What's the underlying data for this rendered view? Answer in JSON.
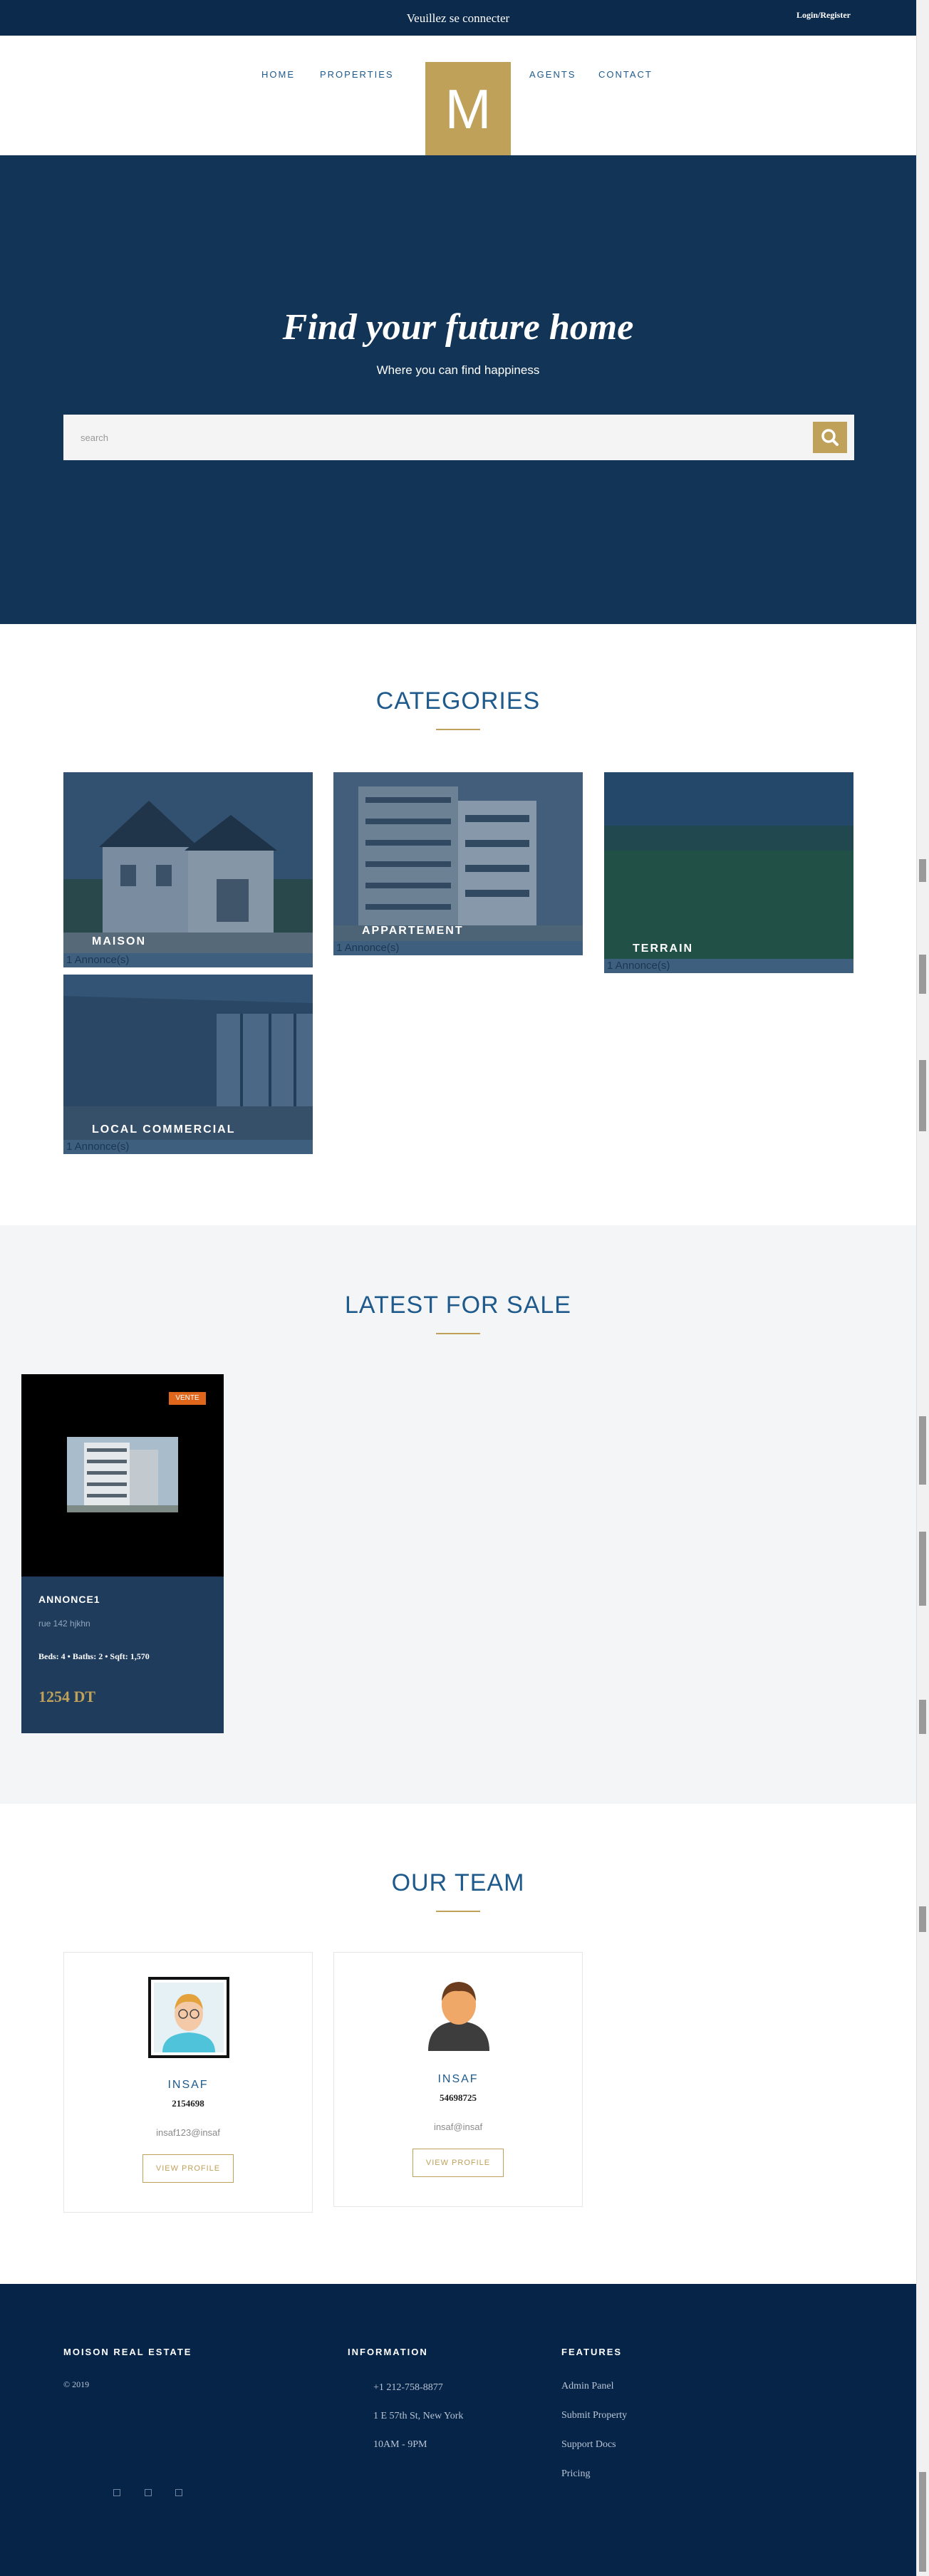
{
  "topbar": {
    "notice": "Veuillez se connecter",
    "login": "Login/Register"
  },
  "nav": {
    "home": "HOME",
    "properties": "PROPERTIES",
    "logo": "M",
    "agents": "AGENTS",
    "contact": "CONTACT"
  },
  "hero": {
    "title": "Find your future home",
    "subtitle": "Where you can find happiness",
    "search_placeholder": "search",
    "search_icon": "search-icon"
  },
  "categories": {
    "title": "CATEGORIES",
    "items": [
      {
        "name": "MAISON",
        "count": "1 Annonce(s)"
      },
      {
        "name": "APPARTEMENT",
        "count": "1 Annonce(s)"
      },
      {
        "name": "TERRAIN",
        "count": "1 Annonce(s)"
      },
      {
        "name": "LOCAL COMMERCIAL",
        "count": "1 Annonce(s)"
      }
    ]
  },
  "latest": {
    "title": "LATEST FOR SALE",
    "listings": [
      {
        "badge": "VENTE",
        "name": "ANNONCE1",
        "address": "rue 142 hjkhn",
        "specs": "Beds: 4  •  Baths: 2  •  Sqft: 1,570",
        "price": "1254 DT"
      }
    ]
  },
  "team": {
    "title": "OUR TEAM",
    "members": [
      {
        "name": "INSAF",
        "phone": "2154698",
        "email": "insaf123@insaf",
        "button": "VIEW PROFILE"
      },
      {
        "name": "INSAF",
        "phone": "54698725",
        "email": "insaf@insaf",
        "button": "VIEW PROFILE"
      }
    ]
  },
  "footer": {
    "brand": "MOISON REAL ESTATE",
    "copyright": "© 2019",
    "information_head": "INFORMATION",
    "phone": "+1 212-758-8877",
    "address": "1 E 57th St, New York",
    "hours": "10AM - 9PM",
    "features_head": "FEATURES",
    "features": [
      "Admin Panel",
      "Submit Property",
      "Support Docs",
      "Pricing"
    ]
  },
  "colors": {
    "navy": "#0c2a4c",
    "hero": "#113457",
    "gold": "#bfa15a",
    "badge": "#e0661c"
  }
}
